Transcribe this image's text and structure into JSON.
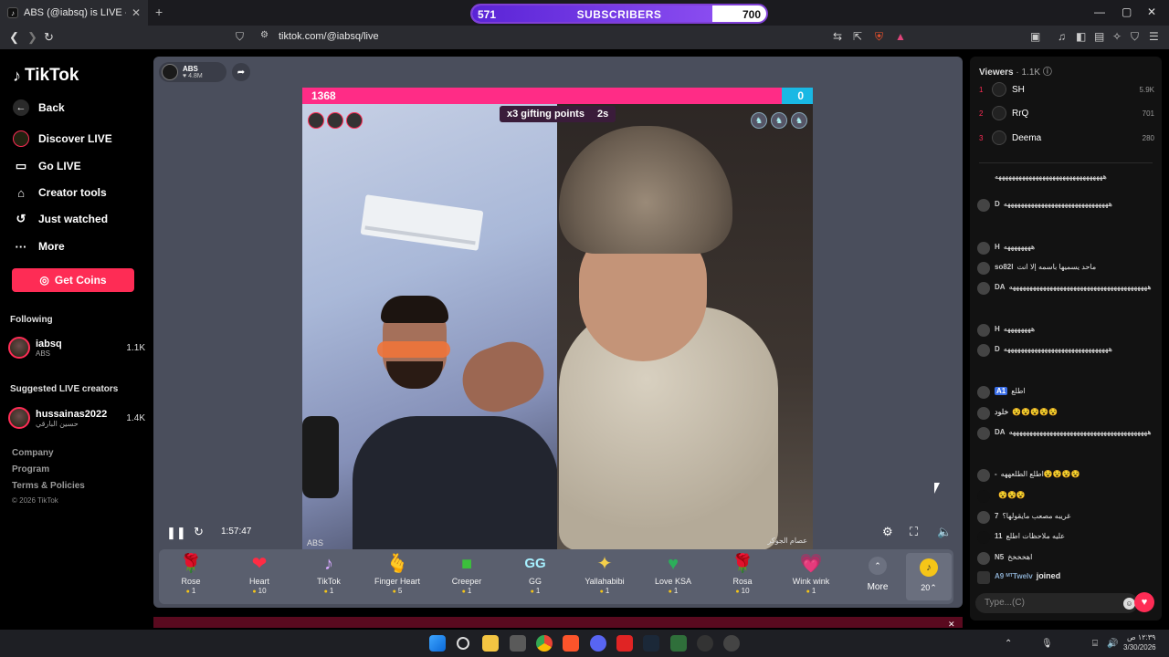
{
  "browser": {
    "tab_title": "ABS (@iabsq) is LIVE - TikTok",
    "tab_close": "✕",
    "new_tab": "+",
    "url": "tiktok.com/@iabsq/live",
    "window_controls": [
      "—",
      "▢",
      "✕"
    ]
  },
  "subscriber_goal": {
    "label": "SUBSCRIBERS",
    "current": "571",
    "goal": "700",
    "progress_fraction": 0.816,
    "accent_color": "#7f3fd6"
  },
  "sidebar": {
    "logo_text": "TikTok",
    "nav": [
      {
        "label": "Back",
        "icon": "back-arrow-icon"
      },
      {
        "label": "Discover LIVE",
        "icon": "live-icon"
      },
      {
        "label": "Go LIVE",
        "icon": "camera-icon"
      },
      {
        "label": "Creator tools",
        "icon": "home-icon"
      },
      {
        "label": "Just watched",
        "icon": "history-icon"
      },
      {
        "label": "More",
        "icon": "more-icon"
      }
    ],
    "get_coins": "Get Coins",
    "following_heading": "Following",
    "following": [
      {
        "name": "iabsq",
        "sub": "ABS",
        "count": "1.1K"
      }
    ],
    "suggested_heading": "Suggested LIVE creators",
    "suggested": [
      {
        "name": "hussainas2022",
        "sub": "حسين البارقي",
        "count": "1.4K"
      }
    ],
    "footer_links": [
      "Company",
      "Program",
      "Terms & Policies"
    ],
    "copyright": "© 2026 TikTok",
    "brand_color": "#fe2c55"
  },
  "player": {
    "host_name": "ABS",
    "host_likes": "♥ 4.8M",
    "score_left": "1368",
    "score_right": "0",
    "gifting_points": "x3 gifting points",
    "gifting_timer": "2s",
    "elapsed": "1:57:47",
    "left_tag": "ABS",
    "right_tag": "عصام الجوكر"
  },
  "gifts": [
    {
      "name": "Rose",
      "price": "1",
      "icon": "🌹"
    },
    {
      "name": "Heart",
      "price": "10",
      "icon": "❤"
    },
    {
      "name": "TikTok",
      "price": "1",
      "icon": "♪"
    },
    {
      "name": "Finger Heart",
      "price": "5",
      "icon": "🫰"
    },
    {
      "name": "Creeper",
      "price": "1",
      "icon": "■"
    },
    {
      "name": "GG",
      "price": "1",
      "icon": "GG"
    },
    {
      "name": "Yallahabibi",
      "price": "1",
      "icon": "✦"
    },
    {
      "name": "Love KSA",
      "price": "1",
      "icon": "♥"
    },
    {
      "name": "Rosa",
      "price": "10",
      "icon": "🌹"
    },
    {
      "name": "Wink wink",
      "price": "1",
      "icon": "💗"
    }
  ],
  "gift_more": "More",
  "coin_count": "20",
  "chat": {
    "viewers_label": "Viewers",
    "viewers_count": "· 1.1K",
    "top_viewers": [
      {
        "rank": "1",
        "name": "SH",
        "score": "5.9K"
      },
      {
        "rank": "2",
        "name": "RrQ",
        "score": "701"
      },
      {
        "rank": "3",
        "name": "Deema",
        "score": "280"
      }
    ],
    "messages": [
      {
        "user": "",
        "text": "ههههههههههههههههههههههههههههههههه"
      },
      {
        "user": "D",
        "text": "هههههههههههههههههههههههههههههههه"
      },
      {
        "user": "H",
        "text": "ههههههههه"
      },
      {
        "user": "so82l",
        "text": "ماحد يسميها باسمه إلا انت"
      },
      {
        "user": "DA",
        "text": "هههههههههههههههههههههههههههههههههههههههههه"
      },
      {
        "user": "H",
        "text": "ههههههههه"
      },
      {
        "user": "D",
        "text": "هههههههههههههههههههههههههههههههه"
      },
      {
        "user": "A1",
        "text": "اطلع"
      },
      {
        "user": "خلود",
        "text": "😵😵😵😵😵"
      },
      {
        "user": "DA",
        "text": "هههههههههههههههههههههههههههههههههههههههههه"
      },
      {
        "user": "-",
        "text": "اطلع الطلعههه😵😵😵😵"
      },
      {
        "user": "",
        "text": "😵😵😵"
      },
      {
        "user": "7",
        "text": "غريبه مصعب مايقولها؟"
      },
      {
        "user": "11",
        "text": "عليه ملاحظات اطلع"
      },
      {
        "user": "N5",
        "text": "اهخخخخ"
      },
      {
        "user": "A9 ᴹᵀTwelv",
        "text": "joined"
      }
    ],
    "input_placeholder": "Type...(C)"
  },
  "taskbar": {
    "time": "١٢:٣٩ ص",
    "date": "3/30/2026"
  }
}
